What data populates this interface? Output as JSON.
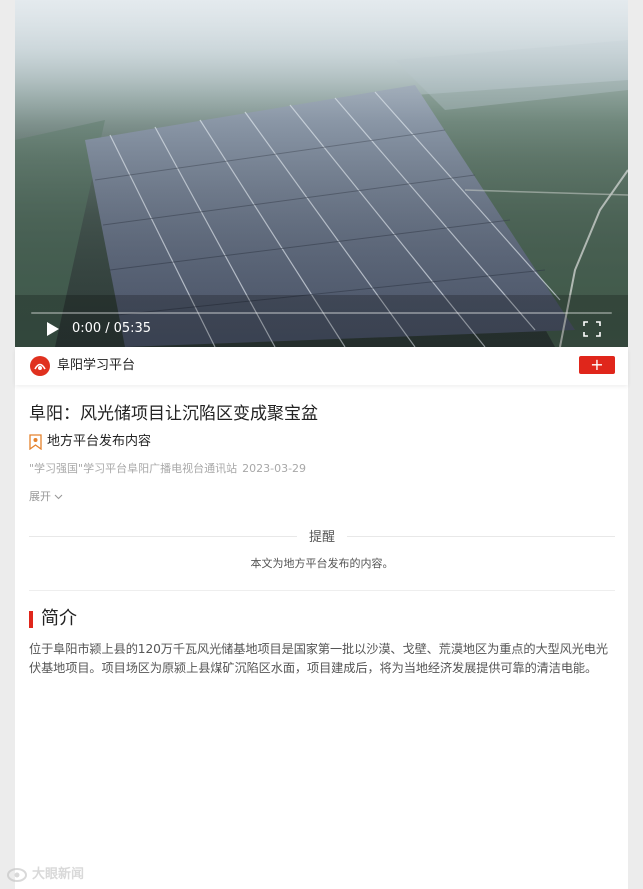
{
  "video": {
    "current_time": "0:00",
    "separator": "/",
    "duration": "05:35",
    "progress": 0
  },
  "publisher": {
    "name": "阜阳学习平台",
    "follow_label": "+"
  },
  "article": {
    "title": "阜阳：风光储项目让沉陷区变成聚宝盆",
    "tag": "地方平台发布内容",
    "source": "\"学习强国\"学习平台阜阳广播电视台通讯站",
    "date": "2023-03-29",
    "expand_label": "展开"
  },
  "notice": {
    "title": "提醒",
    "text": "本文为地方平台发布的内容。"
  },
  "intro": {
    "heading": "简介",
    "body": "位于阜阳市颍上县的120万千瓦风光储基地项目是国家第一批以沙漠、戈壁、荒漠地区为重点的大型风光电光伏基地项目。项目场区为原颍上县煤矿沉陷区水面，项目建成后，将为当地经济发展提供可靠的清洁电能。"
  },
  "watermark": {
    "text": "大眼新闻"
  },
  "colors": {
    "accent": "#e0261b",
    "text_primary": "#222222",
    "text_muted": "#a8a8a8"
  },
  "icons": {
    "play": "play-icon",
    "fullscreen": "fullscreen-icon",
    "tag": "bookmark-icon",
    "expand": "chevron-down-icon"
  }
}
